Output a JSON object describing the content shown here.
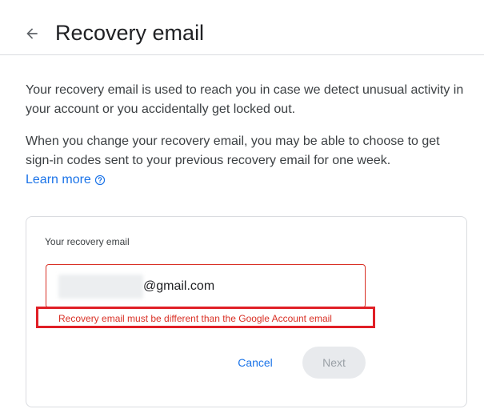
{
  "header": {
    "title": "Recovery email",
    "back_icon": "arrow-back-icon"
  },
  "description": {
    "paragraph1": "Your recovery email is used to reach you in case we detect unusual activity in your account or you accidentally get locked out.",
    "paragraph2": "When you change your recovery email, you may be able to choose to get sign-in codes sent to your previous recovery email for one week.",
    "learn_more": "Learn more",
    "help_icon": "help-circle-icon"
  },
  "form": {
    "label": "Your recovery email",
    "email_domain": "@gmail.com",
    "error": "Recovery email must be different than the Google Account email",
    "cancel_label": "Cancel",
    "next_label": "Next",
    "next_disabled": true
  },
  "colors": {
    "link": "#1a73e8",
    "error": "#d93025",
    "annotation": "#e01f26"
  }
}
